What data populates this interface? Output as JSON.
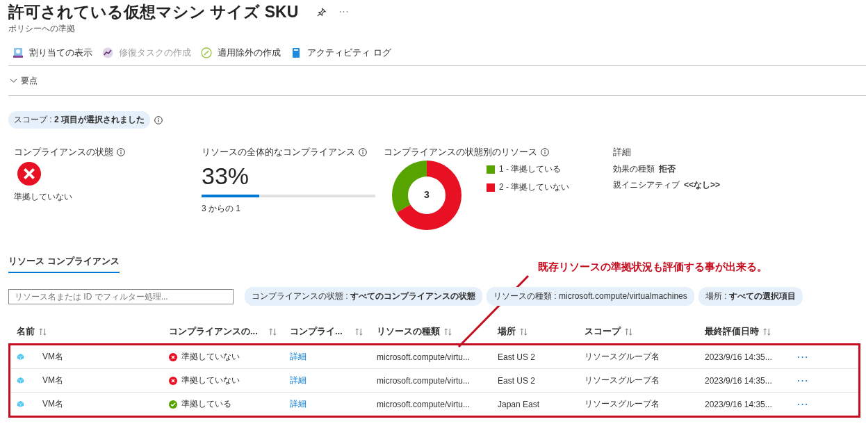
{
  "header": {
    "title": "許可されている仮想マシン サイズ SKU",
    "subtitle": "ポリシーへの準拠"
  },
  "toolbar": [
    {
      "kind": "assignment",
      "label": "割り当ての表示",
      "disabled": false
    },
    {
      "kind": "remediation",
      "label": "修復タスクの作成",
      "disabled": true
    },
    {
      "kind": "exemption",
      "label": "適用除外の作成",
      "disabled": false
    },
    {
      "kind": "log",
      "label": "アクティビティ ログ",
      "disabled": false
    }
  ],
  "essentials": {
    "label": "要点",
    "expanded": false
  },
  "scope": {
    "label": "スコープ : ",
    "value": "2 項目が選択されました"
  },
  "summary": {
    "state": {
      "title": "コンプライアンスの状態",
      "kind": "noncompliant",
      "text": "準拠していない"
    },
    "overall": {
      "title": "リソースの全体的なコンプライアンス",
      "percent": "33%",
      "level": 0.33,
      "caption": "3 からの 1"
    },
    "by_state": {
      "title": "コンプライアンスの状態別のリソース",
      "total": "3",
      "chart_data": {
        "type": "donut",
        "categories": [
          "1 - 準拠している",
          "2 - 準拠していない"
        ],
        "values": [
          1,
          2
        ],
        "colors": [
          "#57a300",
          "#e81123"
        ]
      }
    },
    "details": {
      "title": "詳細",
      "items": [
        {
          "label": "効果の種類",
          "value": "拒否"
        },
        {
          "label": "親イニシアティブ",
          "value": "<<なし>>"
        }
      ]
    }
  },
  "tabs": [
    {
      "label": "リソース コンプライアンス",
      "selected": true
    }
  ],
  "filter": {
    "placeholder": "リソース名または ID でフィルター処理..."
  },
  "filter_pills": [
    {
      "label": "コンプライアンスの状態 : ",
      "value": "すべてのコンプライアンスの状態",
      "bold": true
    },
    {
      "label": "リソースの種類 : ",
      "value": "microsoft.compute/virtualmachines",
      "bold": false
    },
    {
      "label": "場所 : ",
      "value": "すべての選択項目",
      "bold": true
    }
  ],
  "annotation": {
    "text": "既存リソースの準拠状況も評価する事が出来る。"
  },
  "table": {
    "columns": [
      "名前",
      "コンプライアンスの...",
      "コンプライ...",
      "リソースの種類",
      "場所",
      "スコープ",
      "最終評価日時"
    ],
    "rows": [
      {
        "name": "VM名",
        "kind": "noncompliant",
        "status_text": "準拠していない",
        "link": "詳細",
        "type": "microsoft.compute/virtu...",
        "location": "East US 2",
        "scope": "リソースグループ名",
        "evaluated": "2023/9/16 14:35..."
      },
      {
        "name": "VM名",
        "kind": "noncompliant",
        "status_text": "準拠していない",
        "link": "詳細",
        "type": "microsoft.compute/virtu...",
        "location": "East US 2",
        "scope": "リソースグループ名",
        "evaluated": "2023/9/16 14:35..."
      },
      {
        "name": "VM名",
        "kind": "compliant",
        "status_text": "準拠している",
        "link": "詳細",
        "type": "microsoft.compute/virtu...",
        "location": "Japan East",
        "scope": "リソースグループ名",
        "evaluated": "2023/9/16 14:35..."
      }
    ]
  }
}
